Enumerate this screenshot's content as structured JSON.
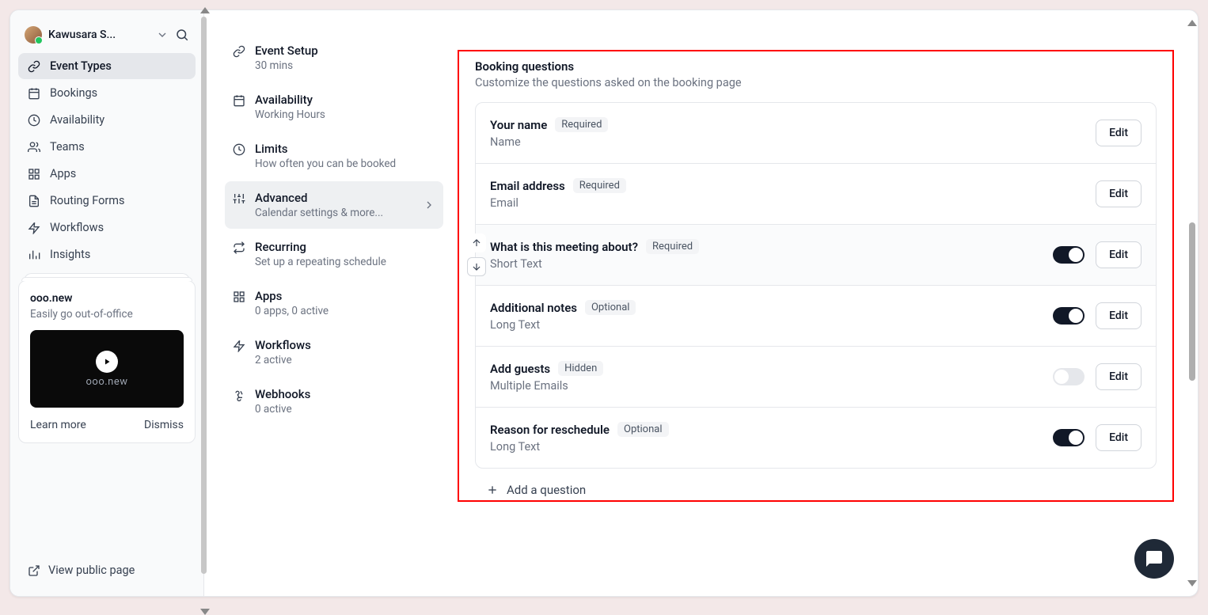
{
  "user": {
    "name": "Kawusara S..."
  },
  "mainNav": [
    {
      "key": "event-types",
      "label": "Event Types",
      "active": true
    },
    {
      "key": "bookings",
      "label": "Bookings"
    },
    {
      "key": "availability",
      "label": "Availability"
    },
    {
      "key": "teams",
      "label": "Teams"
    },
    {
      "key": "apps",
      "label": "Apps"
    },
    {
      "key": "routing",
      "label": "Routing Forms"
    },
    {
      "key": "workflows",
      "label": "Workflows"
    },
    {
      "key": "insights",
      "label": "Insights"
    }
  ],
  "promo": {
    "title": "ooo.new",
    "subtitle": "Easily go out-of-office",
    "logo": "ooo.new",
    "learn": "Learn more",
    "dismiss": "Dismiss"
  },
  "publicPage": "View public page",
  "settingsNav": [
    {
      "key": "event-setup",
      "title": "Event Setup",
      "sub": "30 mins"
    },
    {
      "key": "availability",
      "title": "Availability",
      "sub": "Working Hours"
    },
    {
      "key": "limits",
      "title": "Limits",
      "sub": "How often you can be booked"
    },
    {
      "key": "advanced",
      "title": "Advanced",
      "sub": "Calendar settings & more...",
      "active": true
    },
    {
      "key": "recurring",
      "title": "Recurring",
      "sub": "Set up a repeating schedule"
    },
    {
      "key": "apps",
      "title": "Apps",
      "sub": "0 apps, 0 active"
    },
    {
      "key": "workflows",
      "title": "Workflows",
      "sub": "2 active"
    },
    {
      "key": "webhooks",
      "title": "Webhooks",
      "sub": "0 active"
    }
  ],
  "section": {
    "title": "Booking questions",
    "subtitle": "Customize the questions asked on the booking page",
    "addLabel": "Add a question",
    "editLabel": "Edit"
  },
  "questions": [
    {
      "title": "Your name",
      "badge": "Required",
      "type": "Name",
      "toggle": null,
      "selected": false
    },
    {
      "title": "Email address",
      "badge": "Required",
      "type": "Email",
      "toggle": null,
      "selected": false
    },
    {
      "title": "What is this meeting about?",
      "badge": "Required",
      "type": "Short Text",
      "toggle": "on",
      "selected": true
    },
    {
      "title": "Additional notes",
      "badge": "Optional",
      "type": "Long Text",
      "toggle": "on",
      "selected": false
    },
    {
      "title": "Add guests",
      "badge": "Hidden",
      "type": "Multiple Emails",
      "toggle": "off",
      "selected": false
    },
    {
      "title": "Reason for reschedule",
      "badge": "Optional",
      "type": "Long Text",
      "toggle": "on",
      "selected": false
    }
  ]
}
